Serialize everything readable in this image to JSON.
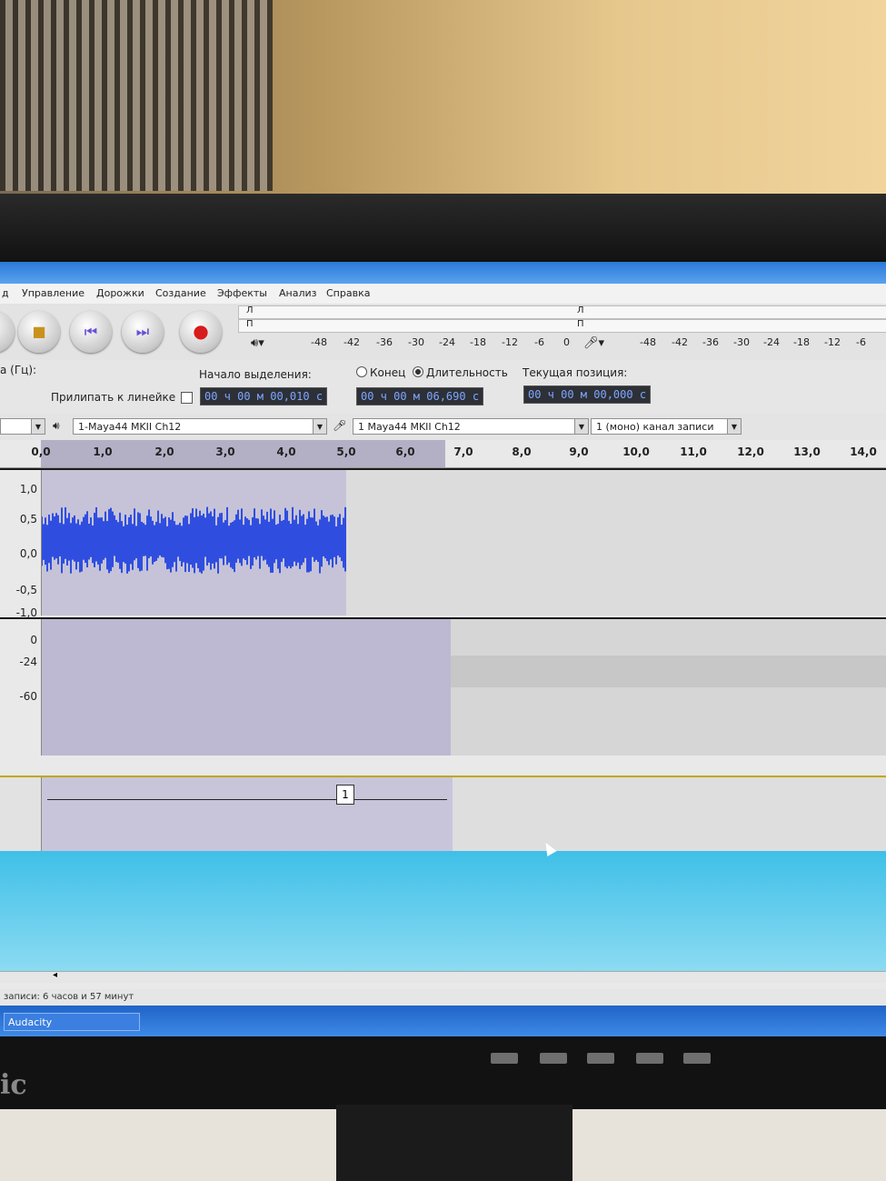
{
  "menu": [
    "д",
    "Управление",
    "Дорожки",
    "Создание",
    "Эффекты",
    "Анализ",
    "Справка"
  ],
  "meters": {
    "left_channel": "Л",
    "right_channel": "П",
    "playback_scale": [
      "-48",
      "-42",
      "-36",
      "-30",
      "-24",
      "-18",
      "-12",
      "-6",
      "0"
    ],
    "record_scale": [
      "-48",
      "-42",
      "-36",
      "-30",
      "-24",
      "-18",
      "-12",
      "-6"
    ]
  },
  "selection": {
    "rate_label": "а (Гц):",
    "snap_label": "Прилипать к линейке",
    "start_label": "Начало выделения:",
    "start_value": "00 ч 00 м 00,010 с",
    "end_label": "Конец",
    "length_label": "Длительность",
    "length_value": "00 ч 00 м 06,690 с",
    "position_label": "Текущая позиция:",
    "position_value": "00 ч 00 м 00,000 с"
  },
  "devices": {
    "playback_device": "1-Maya44 MKII Ch12",
    "record_device": "1 Maya44 MKII Ch12",
    "channels": "1 (моно) канал записи"
  },
  "ruler": [
    "0,0",
    "1,0",
    "2,0",
    "3,0",
    "4,0",
    "5,0",
    "6,0",
    "7,0",
    "8,0",
    "9,0",
    "10,0",
    "11,0",
    "12,0",
    "13,0",
    "14,0"
  ],
  "tracks": {
    "waveform_labels": [
      "1,0",
      "0,5",
      "0,0",
      "-0,5",
      "-1,0"
    ],
    "spectrum_labels": [
      "0",
      "-24",
      "-60"
    ],
    "label_track_clip": "1"
  },
  "status": "записи: 6 часов и 57 минут",
  "taskbar": {
    "app": "Audacity"
  },
  "colors": {
    "waveform": "#2f4ee0",
    "selection": "#c6c3d8",
    "taskbar": "#2a72d8"
  }
}
